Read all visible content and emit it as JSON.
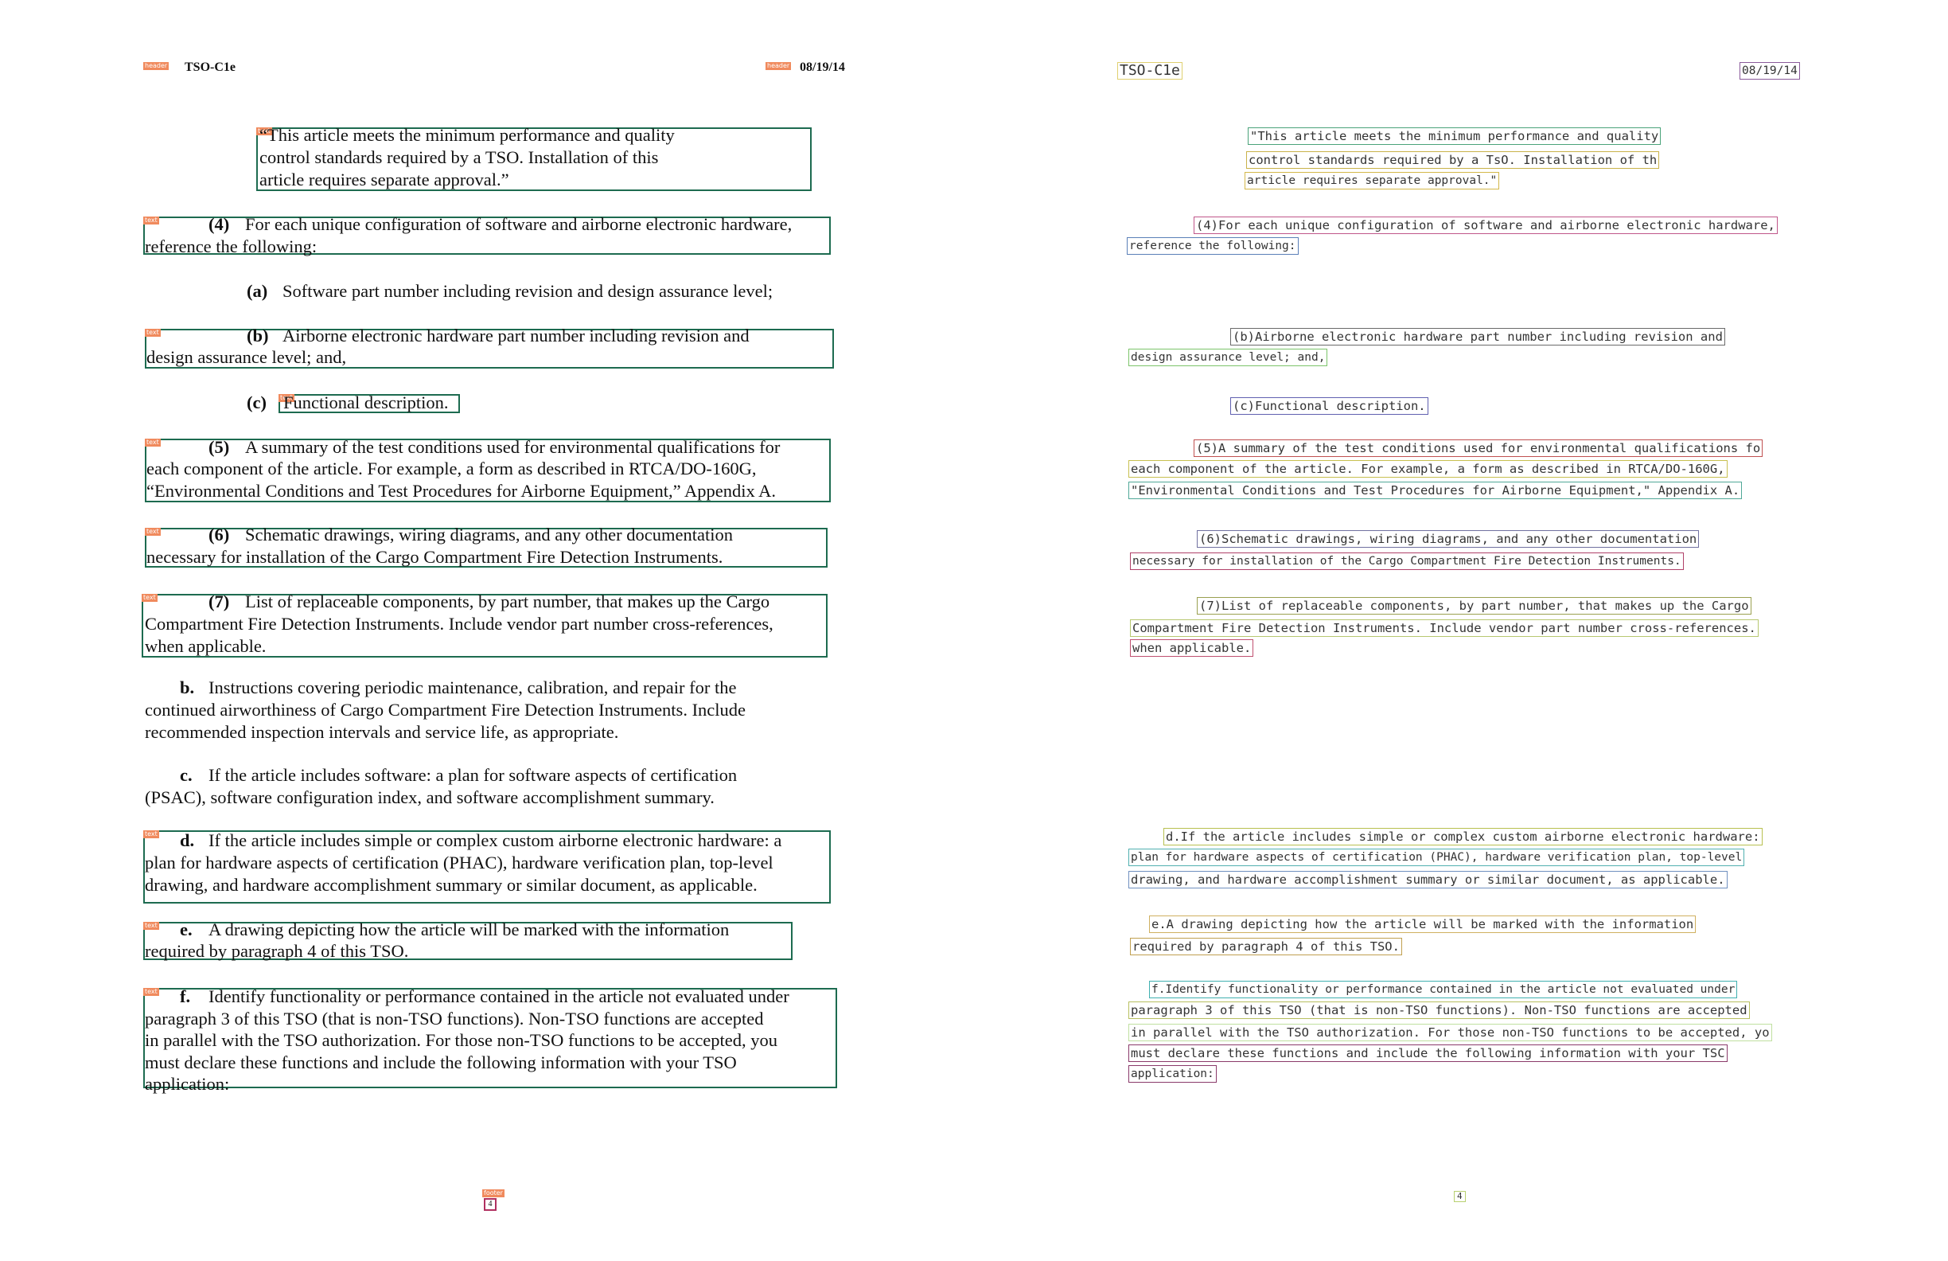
{
  "left": {
    "header_left": "TSO-C1e",
    "header_right": "08/19/14",
    "header_tag": "header",
    "block_tag": "text",
    "footer_tag": "footer",
    "page_number": "4",
    "paragraphs": [
      {
        "id": "q1",
        "lines": [
          "“This article meets the minimum performance and quality",
          "control standards required by a TSO.  Installation of this",
          "article requires separate approval.”"
        ]
      },
      {
        "id": "p4",
        "label": "(4)",
        "lines": [
          "For each unique configuration of software and airborne electronic hardware,",
          "reference the following:"
        ]
      },
      {
        "id": "pa",
        "label": "(a)",
        "lines": [
          "Software part number including revision and design assurance level;"
        ]
      },
      {
        "id": "pb",
        "label": "(b)",
        "lines": [
          "Airborne electronic hardware part number including revision and",
          "design assurance level; and,"
        ]
      },
      {
        "id": "pc",
        "label": "(c)",
        "lines": [
          "Functional description."
        ]
      },
      {
        "id": "p5",
        "label": "(5)",
        "lines": [
          "A summary of the test conditions used for environmental qualifications for",
          "each component of the article.  For example, a form as described in RTCA/DO-160G,",
          "“Environmental Conditions and Test Procedures for Airborne Equipment,” Appendix A."
        ]
      },
      {
        "id": "p6",
        "label": "(6)",
        "lines": [
          "Schematic drawings, wiring diagrams, and any other documentation",
          "necessary for installation of the Cargo Compartment Fire Detection Instruments."
        ]
      },
      {
        "id": "p7",
        "label": "(7)",
        "lines": [
          "List of replaceable components, by part number, that makes up the Cargo",
          "Compartment Fire Detection Instruments.  Include vendor part number cross-references,",
          "when applicable."
        ]
      },
      {
        "id": "pbb",
        "label": "b.",
        "lines": [
          "Instructions covering periodic maintenance, calibration, and repair for the",
          "continued airworthiness of Cargo Compartment Fire Detection Instruments.  Include",
          "recommended inspection intervals and service life, as appropriate."
        ]
      },
      {
        "id": "pcc",
        "label": "c.",
        "lines": [
          "If the article includes software: a plan for software aspects of certification",
          "(PSAC), software configuration index, and software accomplishment summary."
        ]
      },
      {
        "id": "pd",
        "label": "d.",
        "lines": [
          "If the article includes simple or complex custom airborne electronic hardware: a",
          "plan for hardware aspects of certification (PHAC), hardware verification plan, top-level",
          "drawing, and hardware accomplishment summary or similar document, as applicable."
        ]
      },
      {
        "id": "pe",
        "label": "e.",
        "lines": [
          "A drawing depicting how the article will be marked with the information",
          "required by paragraph 4 of this TSO."
        ]
      },
      {
        "id": "pf",
        "label": "f.",
        "lines": [
          "Identify functionality or performance contained in the article not evaluated under",
          "paragraph 3 of this TSO (that is non-TSO functions).   Non-TSO functions are accepted",
          "in parallel with the TSO authorization.   For those non-TSO functions to be accepted, you",
          "must declare these functions and include the following information with your TSO",
          "application:"
        ]
      }
    ]
  },
  "right": {
    "header_left": "TSO-C1e",
    "header_right": "08/19/14",
    "page_number": "4",
    "lines": [
      "\"This article meets the minimum performance and quality",
      "control standards required by a TsO. Installation of th",
      "article requires separate approval.\"",
      "(4)For each unique configuration of software and airborne electronic hardware,",
      "reference the following:",
      "(b)Airborne electronic hardware part number including revision and",
      "design assurance level; and,",
      "(c)Functional description.",
      "(5)A summary of the test conditions used for environmental qualifications fo",
      "each component of the article. For example, a form as described in RTCA/DO-160G,",
      "\"Environmental Conditions and Test Procedures for Airborne Equipment,\" Appendix A.",
      "(6)Schematic drawings, wiring diagrams, and any other documentation",
      "necessary for installation of the Cargo Compartment Fire Detection Instruments.",
      "(7)List of replaceable components, by part number, that makes up the Cargo",
      "Compartment Fire Detection Instruments. Include vendor part number cross-references.",
      "when applicable.",
      "d.If the article includes simple or complex custom airborne electronic hardware:",
      "plan for hardware aspects of certification (PHAC), hardware verification plan, top-level",
      "drawing, and hardware accomplishment summary or similar document, as applicable.",
      "e.A drawing depicting how the article will be marked with the information",
      "required by paragraph 4 of this TSO.",
      "f.Identify functionality or performance contained in the article not evaluated under",
      "paragraph 3 of this TSO (that is non-TSO functions). Non-TSO functions are accepted",
      "in parallel with the TSO authorization. For those non-TSO functions to be accepted, yo",
      "must declare these functions and include the following information with your TSC",
      "application:"
    ],
    "box_colors": [
      "#4aa37a",
      "#c9b24a",
      "#d4b84a",
      "#c0568a",
      "#5a7fb8",
      "#6a6a6a",
      "#7cc46a",
      "#6060b0",
      "#c05050",
      "#c8c050",
      "#50a898",
      "#7070a0",
      "#b04068",
      "#9aa050",
      "#b8c870",
      "#c05070",
      "#b8c050",
      "#50b0b0",
      "#7090c0",
      "#d0b060",
      "#c0a050",
      "#40b0b0",
      "#b8c060",
      "#c0e0a0",
      "#8a3a6a",
      "#8a3a6a"
    ]
  }
}
